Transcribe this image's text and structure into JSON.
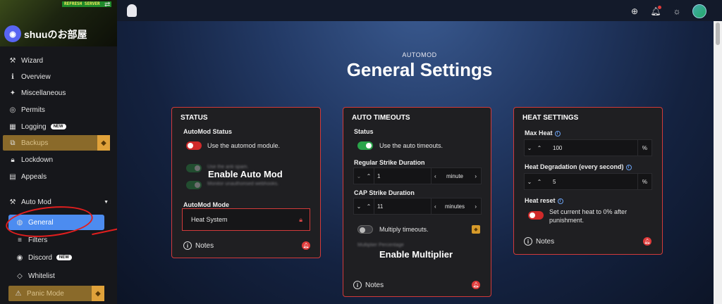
{
  "sidebar": {
    "banner_text": "REFRESH SERVER",
    "guild_name": "shuuのお部屋",
    "items": [
      {
        "label": "Wizard",
        "icon": "wand-icon"
      },
      {
        "label": "Overview",
        "icon": "info-icon"
      },
      {
        "label": "Miscellaneous",
        "icon": "sparkle-icon"
      },
      {
        "label": "Permits",
        "icon": "fingerprint-icon"
      },
      {
        "label": "Logging",
        "icon": "calendar-icon",
        "badge": "NEW"
      },
      {
        "label": "Backups",
        "icon": "backup-icon",
        "premium": true
      },
      {
        "label": "Lockdown",
        "icon": "lock-icon"
      },
      {
        "label": "Appeals",
        "icon": "document-icon"
      }
    ],
    "automod": {
      "label": "Auto Mod",
      "children": [
        {
          "label": "General",
          "active": true
        },
        {
          "label": "Filters"
        },
        {
          "label": "Discord",
          "badge": "NEW"
        },
        {
          "label": "Whitelist"
        },
        {
          "label": "Panic Mode",
          "premium": true
        }
      ]
    }
  },
  "page": {
    "eyebrow": "AUTOMOD",
    "title": "General Settings"
  },
  "status_card": {
    "title": "STATUS",
    "automod_status_label": "AutoMod Status",
    "automod_toggle_text": "Use the automod module.",
    "blurred_1": "Use the anti spam.",
    "blurred_2": "Monitor unauthorised webhooks.",
    "overlay": "Enable Auto Mod",
    "mode_label": "AutoMod Mode",
    "mode_value": "Heat System",
    "notes": "Notes"
  },
  "timeouts_card": {
    "title": "AUTO TIMEOUTS",
    "status_label": "Status",
    "status_text": "Use the auto timeouts.",
    "regular_label": "Regular Strike Duration",
    "regular_value": "1",
    "regular_unit": "minute",
    "cap_label": "CAP Strike Duration",
    "cap_value": "11",
    "cap_unit": "minutes",
    "multiply_text": "Multiply timeouts.",
    "blurred_multiplier": "Multiplier Percentage",
    "overlay": "Enable Multiplier",
    "notes": "Notes"
  },
  "heat_card": {
    "title": "HEAT SETTINGS",
    "max_heat_label": "Max Heat",
    "max_heat_value": "100",
    "max_heat_unit": "%",
    "degradation_label": "Heat Degradation (every second)",
    "degradation_value": "5",
    "degradation_unit": "%",
    "reset_label": "Heat reset",
    "reset_text_1": "Set current heat to 0% after",
    "reset_text_2": "punishment.",
    "notes": "Notes"
  },
  "colors": {
    "accent": "#4c8cf0",
    "danger": "#d23a3a",
    "success": "#2aa44a",
    "premium": "#e0a23a"
  }
}
